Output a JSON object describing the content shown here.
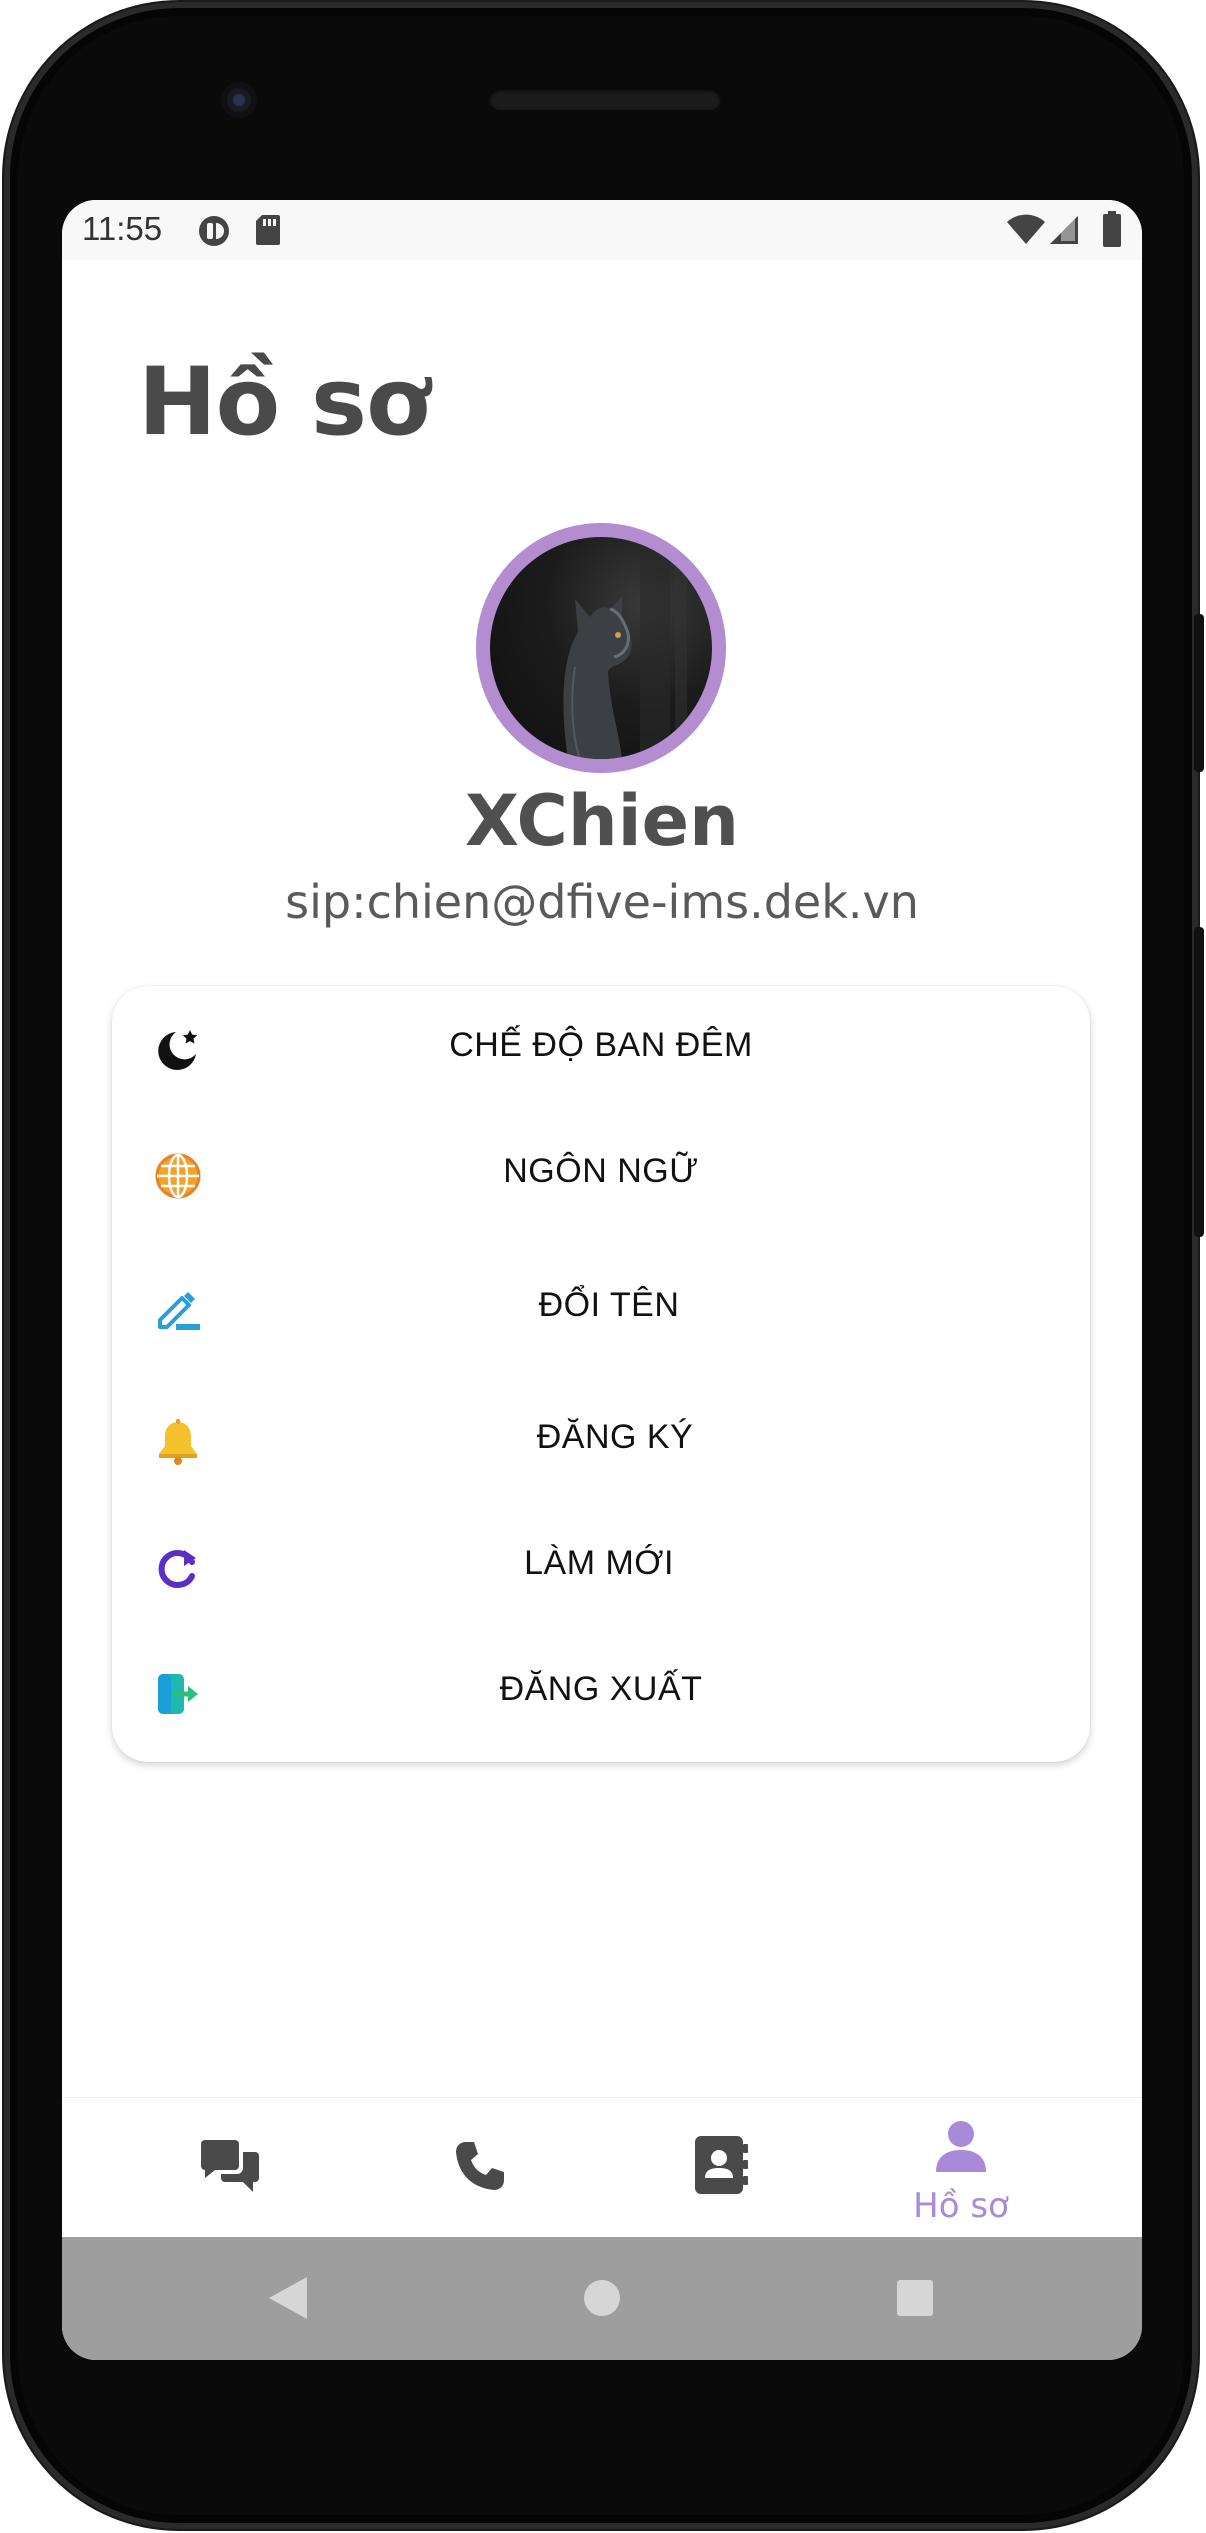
{
  "status_bar": {
    "time": "11:55"
  },
  "page": {
    "title": "Hồ sơ"
  },
  "profile": {
    "name": "XChien",
    "sip": "sip:chien@dfive-ims.dek.vn"
  },
  "menu": {
    "items": [
      {
        "label": "CHẾ ĐỘ BAN ĐÊM",
        "icon": "moon-star-icon"
      },
      {
        "label": "NGÔN NGỮ",
        "icon": "globe-icon"
      },
      {
        "label": "ĐỔI TÊN",
        "icon": "edit-pencil-icon"
      },
      {
        "label": "ĐĂNG KÝ",
        "icon": "bell-icon"
      },
      {
        "label": "LÀM MỚI",
        "icon": "refresh-icon"
      },
      {
        "label": "ĐĂNG XUẤT",
        "icon": "logout-icon"
      }
    ]
  },
  "bottom_nav": {
    "items": [
      {
        "icon": "chat-icon",
        "label": ""
      },
      {
        "icon": "phone-icon",
        "label": ""
      },
      {
        "icon": "contacts-icon",
        "label": ""
      },
      {
        "icon": "profile-icon",
        "label": "Hồ sơ",
        "active": true
      }
    ],
    "active_color": "#a88ad8",
    "inactive_color": "#4a4a4a"
  },
  "system_nav": {
    "buttons": [
      "back-icon",
      "home-icon",
      "recents-icon"
    ]
  },
  "colors": {
    "avatar_ring": "#b48cd0",
    "accent": "#a88ad8"
  }
}
